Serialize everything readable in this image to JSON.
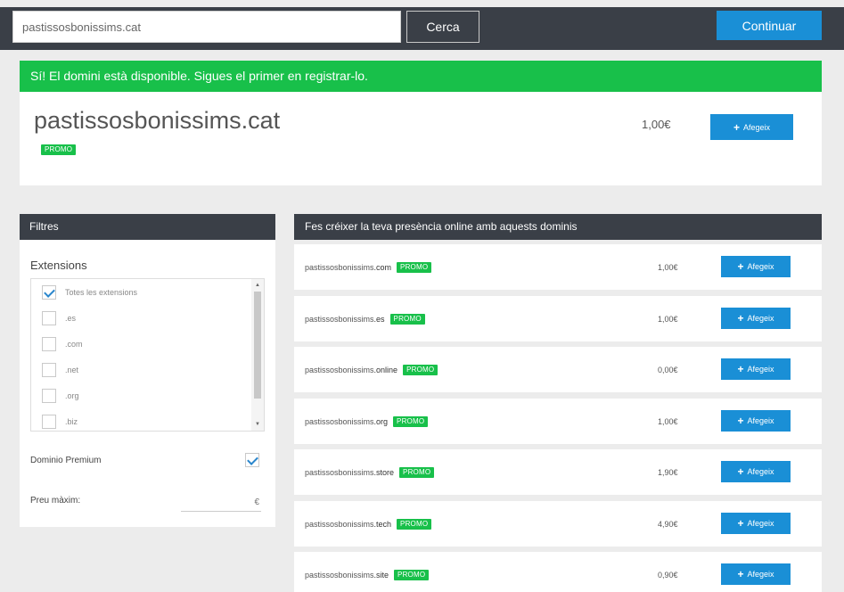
{
  "topbar": {
    "search_value": "pastissosbonissims.cat",
    "search_label": "Cerca",
    "continue_label": "Continuar"
  },
  "availability": {
    "banner": "Sí! El domini està disponible. Sigues el primer en registrar-lo.",
    "domain": "pastissosbonissims.cat",
    "promo": "PROMO",
    "price": "1,00€",
    "add_label": "Afegeix"
  },
  "filters": {
    "title": "Filtres",
    "extensions_title": "Extensions",
    "extensions": [
      {
        "label": "Totes les extensions",
        "checked": true
      },
      {
        "label": ".es",
        "checked": false
      },
      {
        "label": ".com",
        "checked": false
      },
      {
        "label": ".net",
        "checked": false
      },
      {
        "label": ".org",
        "checked": false
      },
      {
        "label": ".biz",
        "checked": false
      }
    ],
    "premium_label": "Dominio Premium",
    "premium_checked": true,
    "max_price_label": "Preu màxim:",
    "max_price_currency": "€"
  },
  "suggestions": {
    "title": "Fes créixer la teva presència online amb aquests dominis",
    "add_label": "Afegeix",
    "promo": "PROMO",
    "rows": [
      {
        "name": "pastissosbonissims",
        "tld": ".com",
        "price": "1,00€"
      },
      {
        "name": "pastissosbonissims",
        "tld": ".es",
        "price": "1,00€"
      },
      {
        "name": "pastissosbonissims",
        "tld": ".online",
        "price": "0,00€"
      },
      {
        "name": "pastissosbonissims",
        "tld": ".org",
        "price": "1,00€"
      },
      {
        "name": "pastissosbonissims",
        "tld": ".store",
        "price": "1,90€"
      },
      {
        "name": "pastissosbonissims",
        "tld": ".tech",
        "price": "4,90€"
      },
      {
        "name": "pastissosbonissims",
        "tld": ".site",
        "price": "0,90€"
      }
    ]
  },
  "colors": {
    "dark": "#3a3f47",
    "green": "#18c04a",
    "blue": "#1a8fd6"
  }
}
